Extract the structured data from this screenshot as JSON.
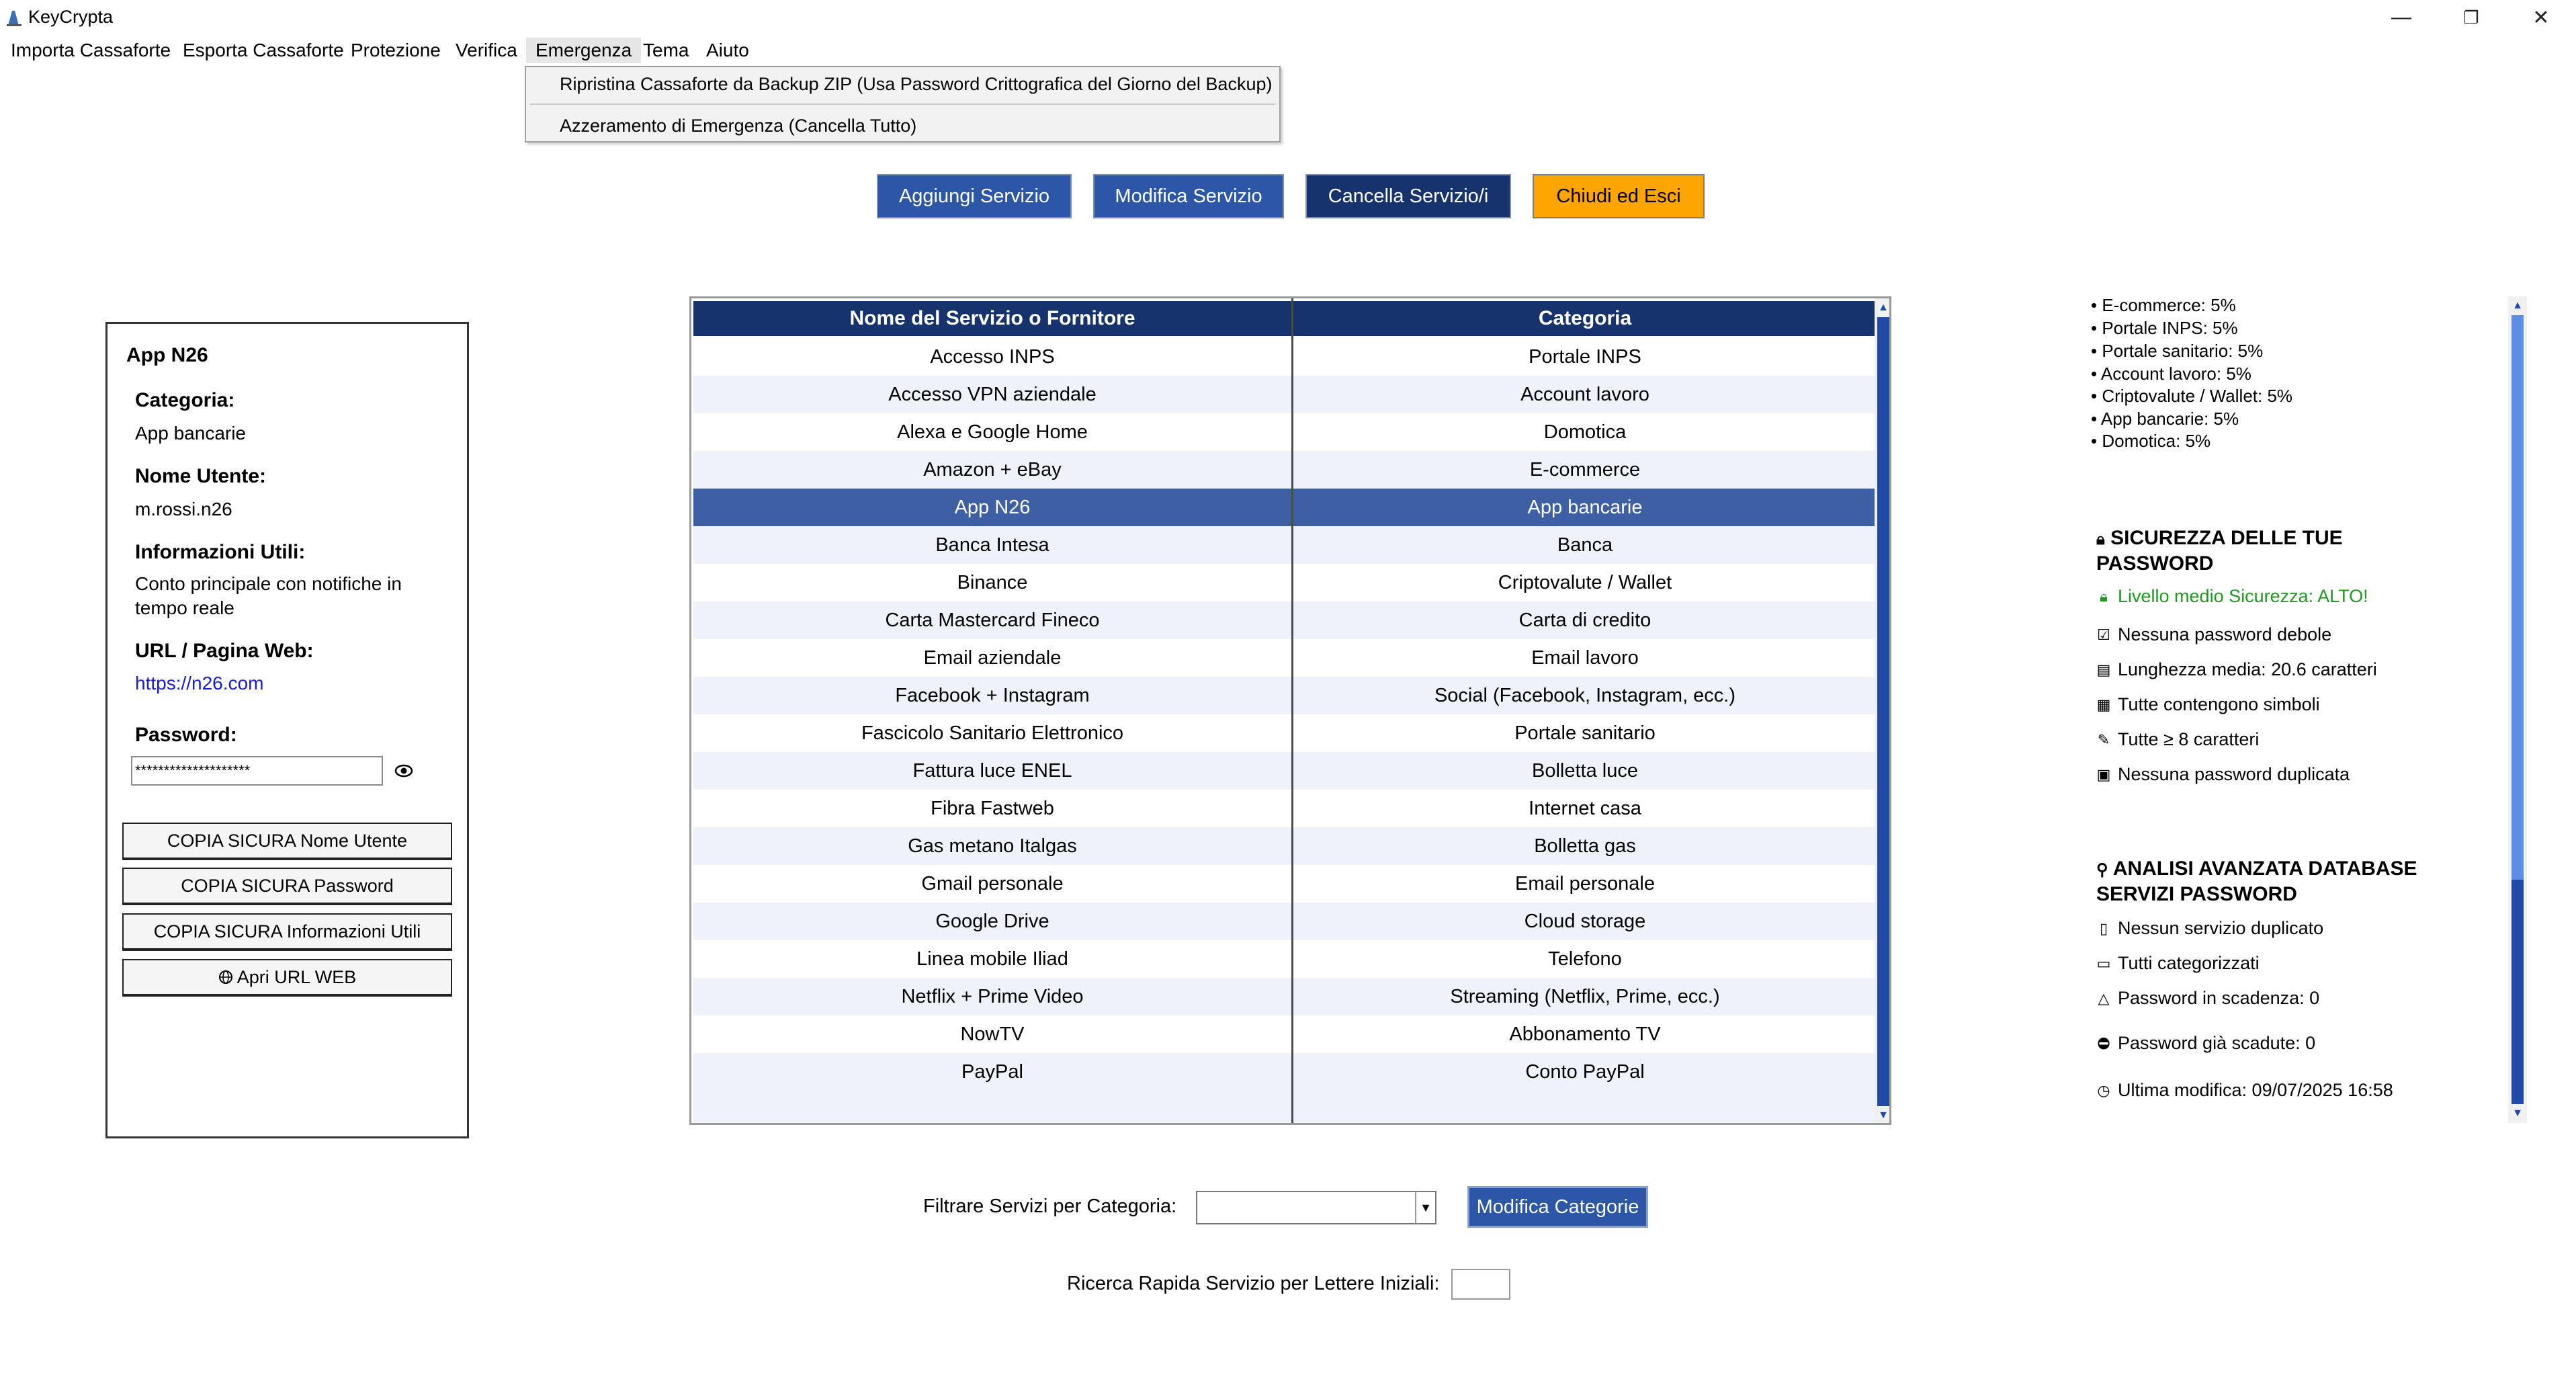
{
  "window": {
    "title": "KeyCrypta",
    "minimize": "—",
    "restore": "❐",
    "close": "✕"
  },
  "menu": {
    "items": [
      "Importa Cassaforte",
      "Esporta Cassaforte",
      "Protezione",
      "Verifica",
      "Emergenza",
      "Tema",
      "Aiuto"
    ],
    "active": "Emergenza",
    "dropdown": [
      "Ripristina Cassaforte da Backup ZIP (Usa Password Crittografica del Giorno del Backup)",
      "Azzeramento di Emergenza (Cancella Tutto)"
    ]
  },
  "toolbar": {
    "add": "Aggiungi Servizio",
    "edit": "Modifica Servizio",
    "delete": "Cancella Servizio/i",
    "exit": "Chiudi ed Esci"
  },
  "details": {
    "title": "App N26",
    "category_label": "Categoria:",
    "category": "App bancarie",
    "username_label": "Nome Utente:",
    "username": "m.rossi.n26",
    "info_label": "Informazioni Utili:",
    "info": "Conto principale con notifiche in tempo reale",
    "url_label": "URL / Pagina Web:",
    "url": "https://n26.com",
    "password_label": "Password:",
    "password": "********************",
    "copy_user": "COPIA SICURA Nome Utente",
    "copy_password": "COPIA SICURA Password",
    "copy_info": "COPIA SICURA Informazioni Utili",
    "open_url": "Apri URL WEB"
  },
  "table": {
    "headers": [
      "Nome del Servizio o Fornitore",
      "Categoria"
    ],
    "selected_index": 4,
    "rows": [
      [
        "Accesso INPS",
        "Portale INPS"
      ],
      [
        "Accesso VPN aziendale",
        "Account lavoro"
      ],
      [
        "Alexa e Google Home",
        "Domotica"
      ],
      [
        "Amazon + eBay",
        "E-commerce"
      ],
      [
        "App N26",
        "App bancarie"
      ],
      [
        "Banca Intesa",
        "Banca"
      ],
      [
        "Binance",
        "Criptovalute / Wallet"
      ],
      [
        "Carta Mastercard Fineco",
        "Carta di credito"
      ],
      [
        "Email aziendale",
        "Email lavoro"
      ],
      [
        "Facebook + Instagram",
        "Social (Facebook, Instagram, ecc.)"
      ],
      [
        "Fascicolo Sanitario Elettronico",
        "Portale sanitario"
      ],
      [
        "Fattura luce ENEL",
        "Bolletta luce"
      ],
      [
        "Fibra Fastweb",
        "Internet casa"
      ],
      [
        "Gas metano Italgas",
        "Bolletta gas"
      ],
      [
        "Gmail personale",
        "Email personale"
      ],
      [
        "Google Drive",
        "Cloud storage"
      ],
      [
        "Linea mobile Iliad",
        "Telefono"
      ],
      [
        "Netflix + Prime Video",
        "Streaming (Netflix, Prime, ecc.)"
      ],
      [
        "NowTV",
        "Abbonamento TV"
      ],
      [
        "PayPal",
        "Conto PayPal"
      ]
    ],
    "scroll_fraction": 0.42
  },
  "filter": {
    "label": "Filtrare Servizi per Categoria:",
    "value": "",
    "edit_categories": "Modifica Categorie",
    "search_label": "Ricerca Rapida Servizio per Lettere Iniziali:",
    "search_value": ""
  },
  "stats": {
    "category_shares": [
      "• E-commerce: 5%",
      "• Portale INPS: 5%",
      "• Portale sanitario: 5%",
      "• Account lavoro: 5%",
      "• Criptovalute / Wallet: 5%",
      "• App bancarie: 5%",
      "• Domotica: 5%"
    ],
    "security_title": "SICUREZZA DELLE TUE PASSWORD",
    "security_level": "Livello medio Sicurezza: ALTO!",
    "security_items": [
      "Nessuna password debole",
      "Lunghezza media: 20.6 caratteri",
      "Tutte contengono simboli",
      "Tutte ≥ 8 caratteri",
      "Nessuna password duplicata"
    ],
    "db_title": "ANALISI AVANZATA DATABASE SERVIZI PASSWORD",
    "db_items": [
      "Nessun servizio duplicato",
      "Tutti categorizzati",
      "Password in scadenza: 0",
      "Password già scadute: 0",
      "Ultima modifica: 09/07/2025 16:58"
    ]
  },
  "colors": {
    "accent_blue": "#2c56a6",
    "dark_navy": "#16336e",
    "orange": "#ffa500",
    "green": "#1e9a1e"
  }
}
